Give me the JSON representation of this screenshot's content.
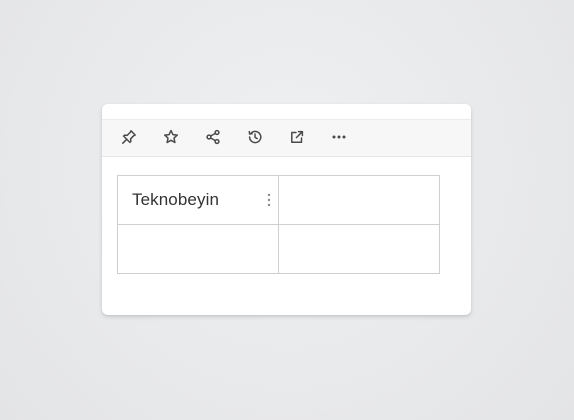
{
  "toolbar": {
    "buttons": [
      {
        "icon": "pin-icon",
        "name": "pin-button"
      },
      {
        "icon": "star-icon",
        "name": "favorite-button"
      },
      {
        "icon": "share-icon",
        "name": "share-button"
      },
      {
        "icon": "history-icon",
        "name": "history-button"
      },
      {
        "icon": "external-link-icon",
        "name": "open-external-button"
      },
      {
        "icon": "more-horizontal-icon",
        "name": "more-options-button"
      }
    ]
  },
  "table": {
    "rows": [
      [
        "Teknobeyin",
        ""
      ],
      [
        "",
        ""
      ]
    ]
  },
  "colors": {
    "background": "#e9eaec",
    "card": "#ffffff",
    "toolbar": "#f7f7f7",
    "icon": "#4a4a4a",
    "text": "#333333",
    "border": "#cfcfcf"
  }
}
